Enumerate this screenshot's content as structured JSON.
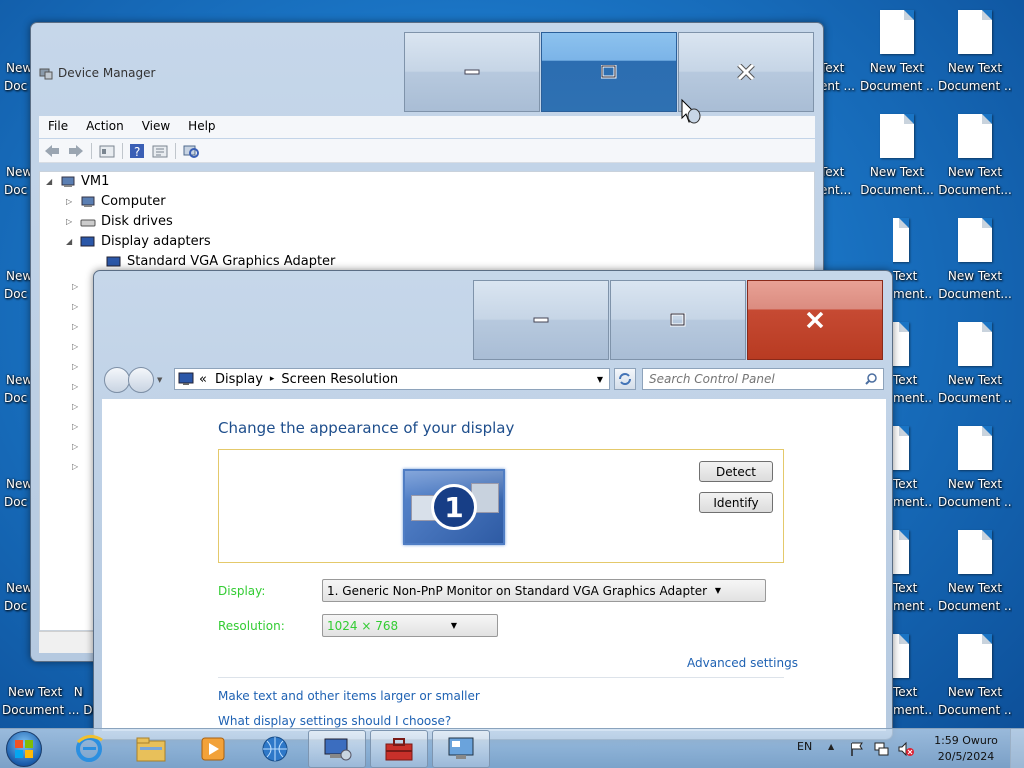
{
  "desktop": {
    "icon_line1": "New Text",
    "icon_line2": "Document ...",
    "icon_line2_b": "Document...",
    "partial_left_line1": "New",
    "partial_left_line2": "Doc",
    "partial_mid_line1": "Text",
    "partial_mid_line2a": "ent ...",
    "partial_mid_line2b": "ent...",
    "partial_mid_line2c": "ment...",
    "partial_mid_line2d": "ment ...",
    "partial_n": "N",
    "partial_do": "Do"
  },
  "device_manager": {
    "title": "Device Manager",
    "menu": [
      "File",
      "Action",
      "View",
      "Help"
    ],
    "tree": {
      "root": "VM1",
      "items": [
        "Computer",
        "Disk drives",
        "Display adapters"
      ],
      "child": "Standard VGA Graphics Adapter"
    }
  },
  "control_panel": {
    "breadcrumb": {
      "chevrons": "«",
      "item1": "Display",
      "sep": "▸",
      "item2": "Screen Resolution"
    },
    "search_placeholder": "Search Control Panel",
    "heading": "Change the appearance of your display",
    "monitor_number": "1",
    "detect_label": "Detect",
    "identify_label": "Identify",
    "display_label": "Display:",
    "display_value": "1. Generic Non-PnP Monitor on Standard VGA Graphics Adapter",
    "resolution_label": "Resolution:",
    "resolution_value": "1024 × 768",
    "advanced_link": "Advanced settings",
    "link1": "Make text and other items larger or smaller",
    "link2": "What display settings should I choose?"
  },
  "taskbar": {
    "language": "EN",
    "time": "1:59 Owuro",
    "date": "20/5/2024",
    "show_hidden": "▲"
  },
  "colors": {
    "heading_blue": "#1e4e8c",
    "label_green": "#33cc33",
    "link_blue": "#1f62b3",
    "close_red": "#c64a33"
  },
  "icons": [
    "start-orb-icon",
    "ie-icon",
    "explorer-icon",
    "media-player-icon",
    "network-icon",
    "device-manager-icon",
    "toolbox-icon",
    "display-settings-icon",
    "flag-icon",
    "speaker-muted-icon"
  ]
}
